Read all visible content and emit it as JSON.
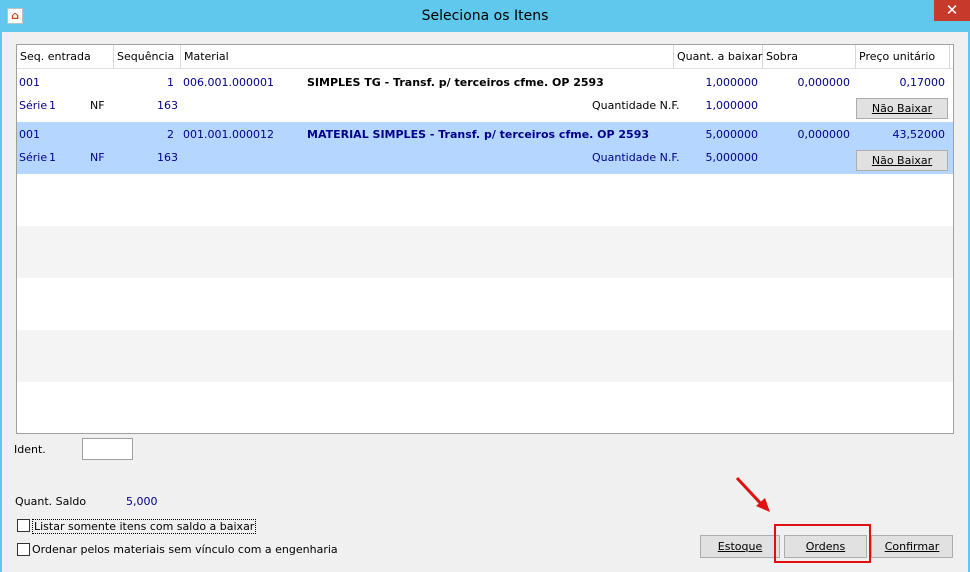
{
  "window": {
    "title": "Seleciona os Itens",
    "close_label": "✕"
  },
  "grid": {
    "columns": [
      "Seq. entrada",
      "Sequência",
      "Material",
      "Quant. a baixar",
      "Sobra",
      "Preço unitário"
    ],
    "rows": [
      {
        "seq_entrada": "001",
        "sequencia": "1",
        "material_code": "006.001.000001",
        "description": "SIMPLES TG - Transf. p/ terceiros cfme. OP 2593",
        "quant_baixar": "1,000000",
        "sobra": "0,000000",
        "preco": "0,17000",
        "serie_label": "Série",
        "serie": "1",
        "nf_label": "NF",
        "nf": "163",
        "qtd_nf_label": "Quantidade N.F.",
        "qtd_nf": "1,000000",
        "button": "Não Baixar"
      },
      {
        "seq_entrada": "001",
        "sequencia": "2",
        "material_code": "001.001.000012",
        "description": "MATERIAL SIMPLES - Transf. p/ terceiros cfme. OP 2593",
        "quant_baixar": "5,000000",
        "sobra": "0,000000",
        "preco": "43,52000",
        "serie_label": "Série",
        "serie": "1",
        "nf_label": "NF",
        "nf": "163",
        "qtd_nf_label": "Quantidade N.F.",
        "qtd_nf": "5,000000",
        "button": "Não Baixar"
      }
    ]
  },
  "ident": {
    "label": "Ident.",
    "value": ""
  },
  "saldo": {
    "label": "Quant. Saldo",
    "value": "5,000"
  },
  "options": {
    "listar_label": "Listar somente itens com saldo a baixar",
    "ordenar_label": "Ordenar pelos materiais sem vínculo com a engenharia"
  },
  "buttons": {
    "estoque": "Estoque",
    "ordens": "Ordens",
    "confirmar": "Confirmar"
  },
  "colors": {
    "titlebar": "#5fc8ec",
    "selected_row": "#b5d7ff",
    "value_text": "#00008b",
    "annotation": "#e01010"
  }
}
